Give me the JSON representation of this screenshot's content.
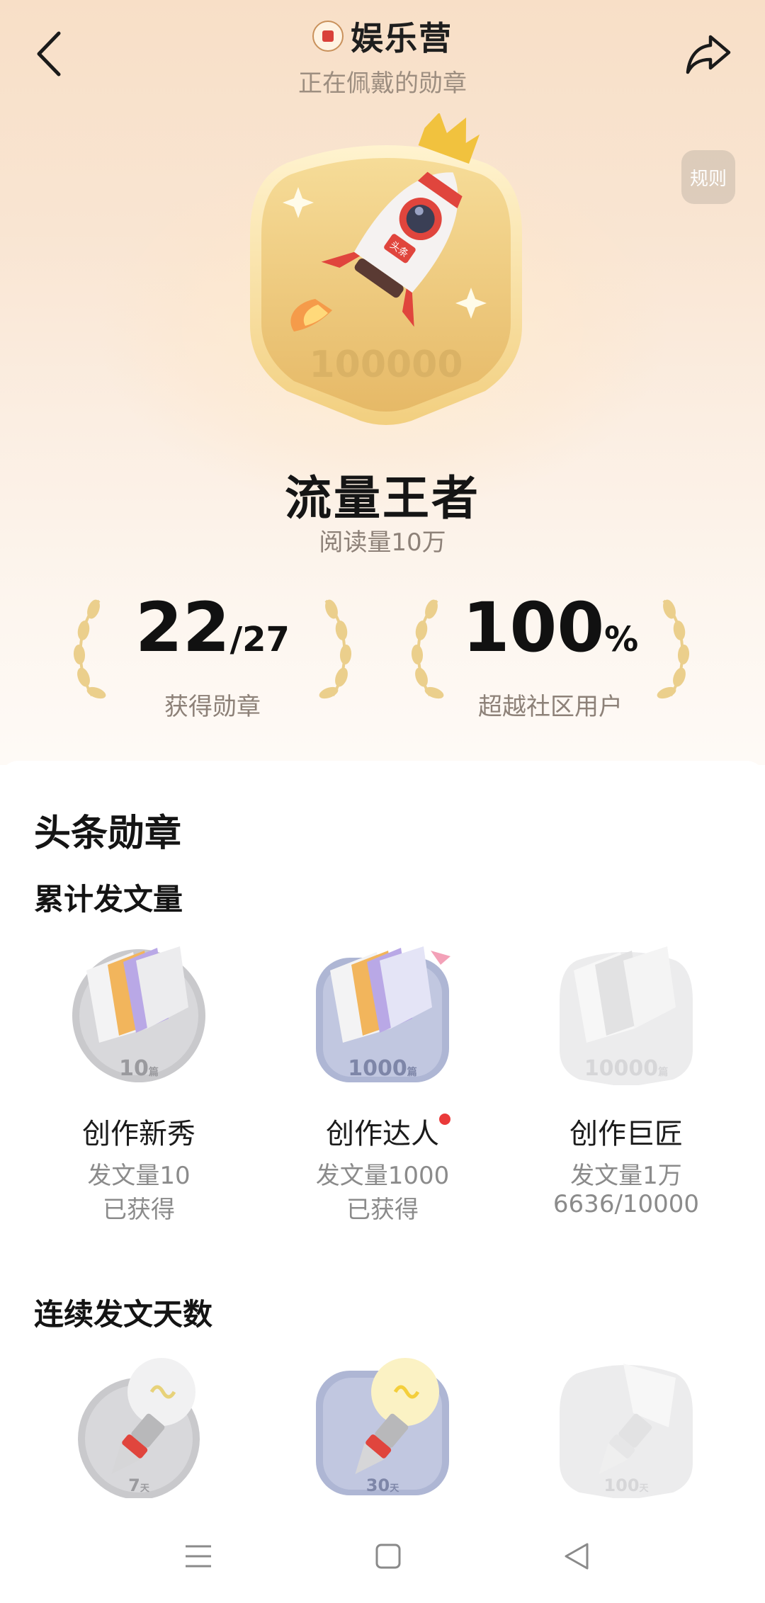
{
  "header": {
    "title": "娱乐营",
    "subtitle": "正在佩戴的勋章",
    "rules_label": "规则"
  },
  "worn_badge": {
    "number": "100000",
    "brand_tag": "头条",
    "name": "流量王者",
    "description": "阅读量10万"
  },
  "stats": {
    "earned": {
      "value": "22",
      "total": "/27",
      "label": "获得勋章"
    },
    "surpass": {
      "value": "100",
      "unit": "%",
      "label": "超越社区用户"
    }
  },
  "section_title": "头条勋章",
  "groups": [
    {
      "title": "累计发文量",
      "medals": [
        {
          "name": "创作新秀",
          "number": "10",
          "unit": "篇",
          "requirement": "发文量10",
          "status": "已获得",
          "state": "earned-silver",
          "new": false
        },
        {
          "name": "创作达人",
          "number": "1000",
          "unit": "篇",
          "requirement": "发文量1000",
          "status": "已获得",
          "state": "earned-blue",
          "new": true
        },
        {
          "name": "创作巨匠",
          "number": "10000",
          "unit": "篇",
          "requirement": "发文量1万",
          "status": "6636/10000",
          "state": "locked",
          "new": false
        }
      ]
    },
    {
      "title": "连续发文天数",
      "medals": [
        {
          "number": "7",
          "unit": "天",
          "state": "earned-silver"
        },
        {
          "number": "30",
          "unit": "天",
          "state": "earned-blue"
        },
        {
          "number": "100",
          "unit": "天",
          "state": "locked"
        }
      ]
    }
  ],
  "nav": {
    "menu": "menu-icon",
    "home": "square-home-icon",
    "back": "triangle-back-icon"
  },
  "colors": {
    "hero_top": "#f8dfc7",
    "gold": "#e9c36c",
    "rocket_red": "#e0453d",
    "silver_medal": "#c9c9cc",
    "blue_medal": "#aeb6d4",
    "locked_medal": "#eeeeee",
    "new_dot": "#ea3a3a"
  }
}
